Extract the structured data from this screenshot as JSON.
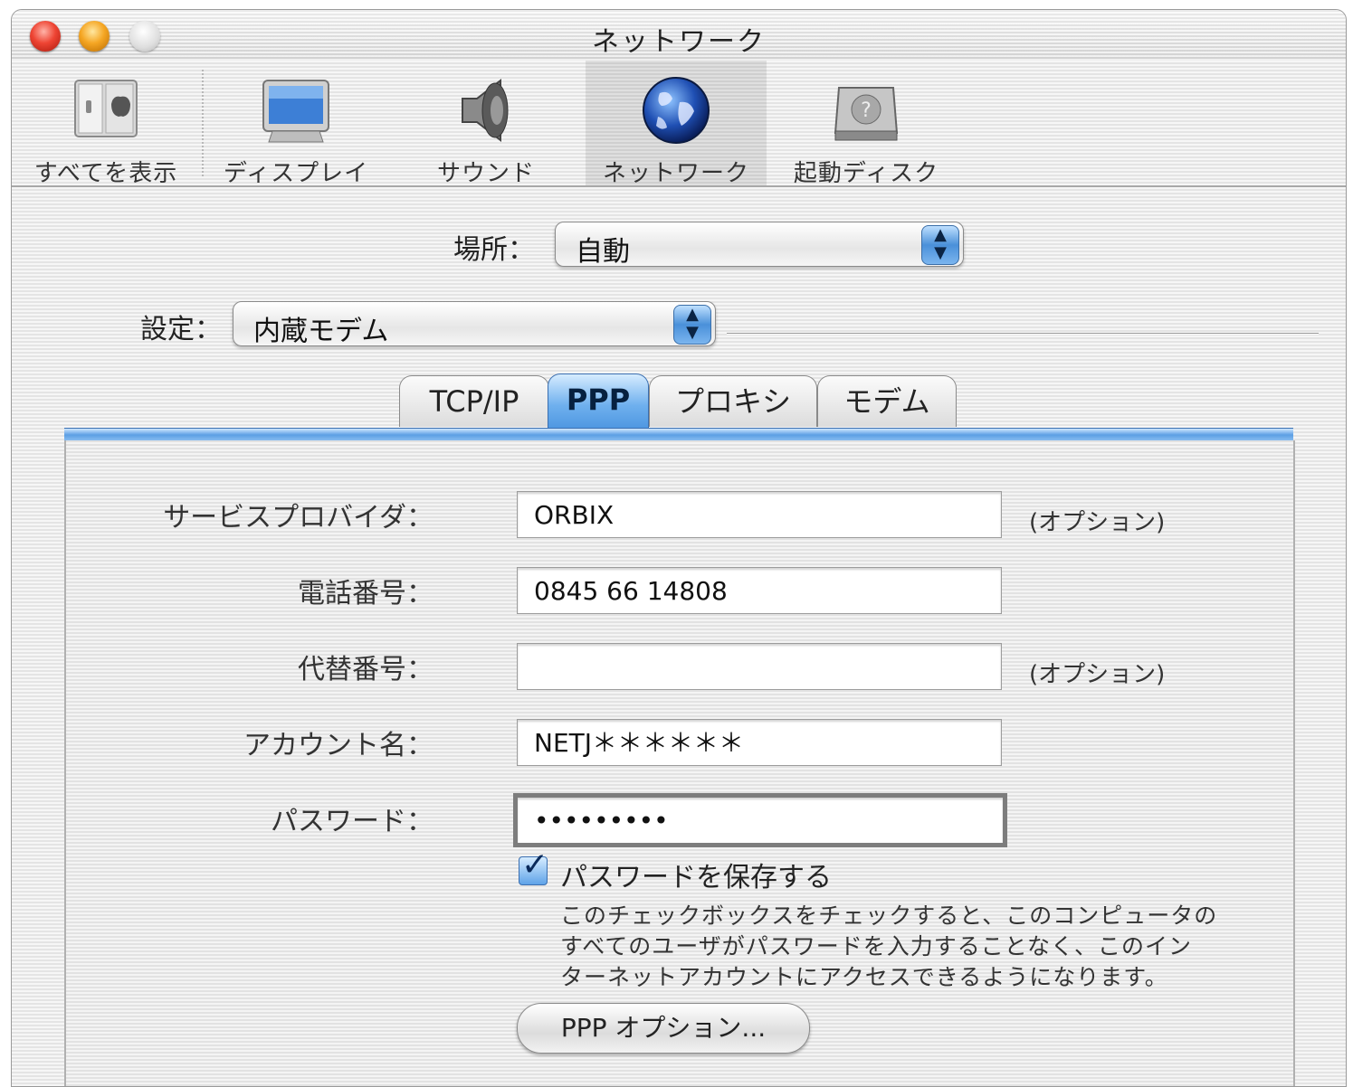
{
  "window": {
    "title": "ネットワーク"
  },
  "toolbar": {
    "items": [
      {
        "label": "すべてを表示",
        "icon": "show-all-icon"
      },
      {
        "label": "ディスプレイ",
        "icon": "display-icon"
      },
      {
        "label": "サウンド",
        "icon": "speaker-icon"
      },
      {
        "label": "ネットワーク",
        "icon": "globe-icon",
        "selected": true
      },
      {
        "label": "起動ディスク",
        "icon": "hard-disk-icon"
      }
    ]
  },
  "location": {
    "label": "場所：",
    "value": "自動"
  },
  "config": {
    "label": "設定：",
    "value": "内蔵モデム"
  },
  "tabs": [
    {
      "label": "TCP/IP"
    },
    {
      "label": "PPP",
      "active": true
    },
    {
      "label": "プロキシ"
    },
    {
      "label": "モデム"
    }
  ],
  "form": {
    "service_provider": {
      "label": "サービスプロバイダ：",
      "value": "ORBIX",
      "note": "(オプション)"
    },
    "phone": {
      "label": "電話番号：",
      "value": "0845 66 14808"
    },
    "alt_phone": {
      "label": "代替番号：",
      "value": "",
      "note": "(オプション)"
    },
    "account": {
      "label": "アカウント名：",
      "value": "NETJ＊＊＊＊＊＊"
    },
    "password": {
      "label": "パスワード：",
      "value": "•••••••••"
    }
  },
  "save_password": {
    "checked": true,
    "label": "パスワードを保存する",
    "description": [
      "このチェックボックスをチェックすると、このコンピュータの",
      "すべてのユーザがパスワードを入力することなく、このイン",
      "ターネットアカウントにアクセスできるようになります。"
    ]
  },
  "ppp_options_button": "PPP オプション...",
  "colors": {
    "accent": "#4c95e0",
    "close": "#ee4433",
    "minimize": "#f5a623"
  }
}
